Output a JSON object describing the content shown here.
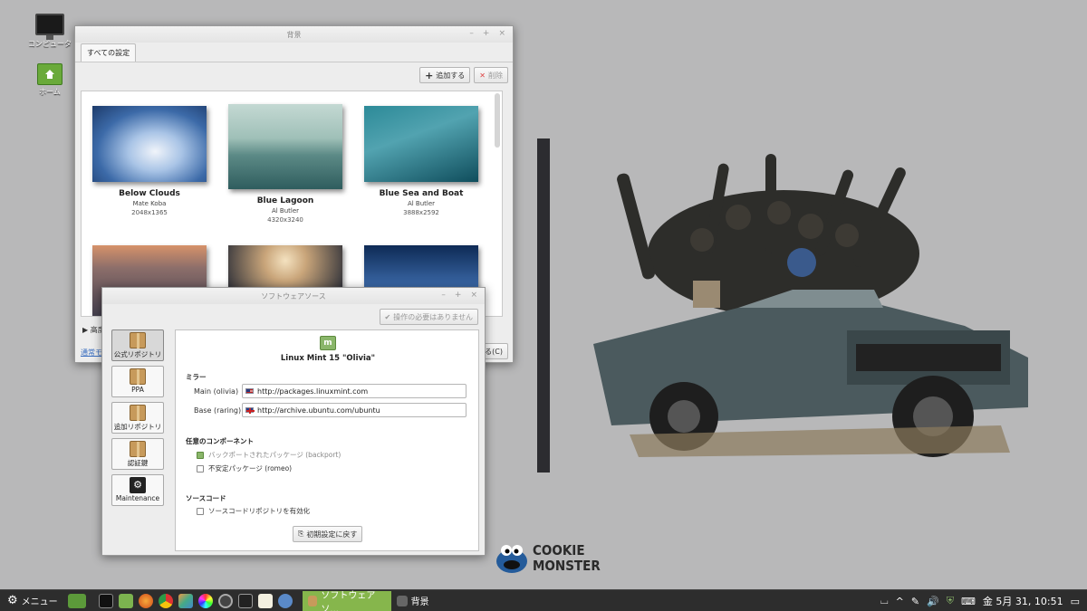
{
  "desktop": {
    "icons": [
      {
        "label": "コンピュータ",
        "icon": "monitor-icon"
      },
      {
        "label": "ホーム",
        "icon": "home-folder-icon"
      }
    ]
  },
  "background_window": {
    "title": "背景",
    "tab": "すべての設定",
    "add_label": "追加する",
    "remove_label": "削除",
    "thumbnails": [
      {
        "name": "Below Clouds",
        "author": "Mate Koba",
        "size": "2048x1365",
        "colors": [
          "#274e8a",
          "#a9c4e6"
        ]
      },
      {
        "name": "Blue Lagoon",
        "author": "Al Butler",
        "size": "4320x3240",
        "colors": [
          "#3d6b6c",
          "#9fc0b8"
        ]
      },
      {
        "name": "Blue Sea and Boat",
        "author": "Al Butler",
        "size": "3888x2592",
        "colors": [
          "#0f4d5c",
          "#52a3b0"
        ]
      },
      {
        "name": "",
        "author": "",
        "size": "",
        "colors": [
          "#3b3a4a",
          "#d6926a"
        ]
      },
      {
        "name": "",
        "author": "",
        "size": "",
        "colors": [
          "#262a35",
          "#c9a57a"
        ]
      },
      {
        "name": "",
        "author": "",
        "size": "",
        "colors": [
          "#0e2a55",
          "#3f6fb0"
        ]
      }
    ],
    "expander_label": "高度",
    "link_label": "通常モ",
    "close_fragment": "る(C)"
  },
  "sources_window": {
    "title": "ソフトウェアソース",
    "apply_label": "操作の必要はありません",
    "sidebar": [
      {
        "label": "公式リポジトリ",
        "icon": "package-icon",
        "active": true
      },
      {
        "label": "PPA",
        "icon": "package-icon",
        "active": false
      },
      {
        "label": "追加リポジトリ",
        "icon": "package-add-icon",
        "active": false
      },
      {
        "label": "認証鍵",
        "icon": "package-key-icon",
        "active": false
      },
      {
        "label": "Maintenance",
        "icon": "maintenance-icon",
        "active": false
      }
    ],
    "distro": "Linux Mint 15 \"Olivia\"",
    "mirror_header": "ミラー",
    "mirrors": [
      {
        "label": "Main (olivia)",
        "url": "http://packages.linuxmint.com",
        "flag": "us-flag-icon"
      },
      {
        "label": "Base (raring)",
        "url": "http://archive.ubuntu.com/ubuntu",
        "flag": "uk-flag-icon"
      }
    ],
    "components_header": "任意のコンポーネント",
    "components": [
      {
        "label": "バックポートされたパッケージ (backport)",
        "checked": true,
        "disabled": true
      },
      {
        "label": "不安定パッケージ (romeo)",
        "checked": false,
        "disabled": false
      }
    ],
    "source_header": "ソースコード",
    "source_option": "ソースコードリポジトリを有効化",
    "reset_label": "初期設定に戻す"
  },
  "wallpaper": {
    "logo_line1": "COOKIE",
    "logo_line2": "MONSTER"
  },
  "taskbar": {
    "menu_label": "メニュー",
    "tasks": [
      {
        "label": "ソフトウェアソ...",
        "active": true
      },
      {
        "label": "背景",
        "active": false
      }
    ],
    "clock": "金  5月 31, 10:51"
  }
}
